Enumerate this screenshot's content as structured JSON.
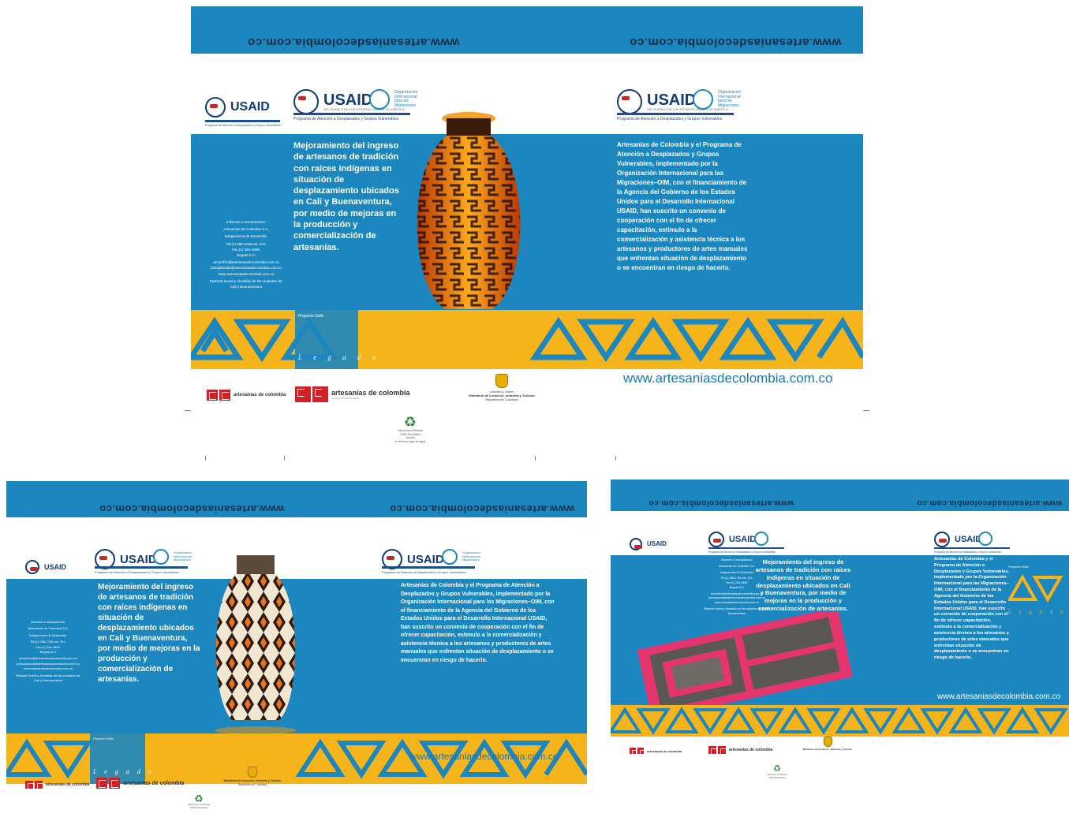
{
  "url_flipped": "www.artesaniasdecolombia.com.co",
  "url": "www.artesaniasdecolombia.com.co",
  "usaid": {
    "name": "USAID",
    "sub": "DEL PUEBLO DE LOS ESTADOS UNIDOS DE AMÉRICA"
  },
  "oim": {
    "line1": "Organización",
    "line2": "Internacional",
    "line3": "para las",
    "line4": "Migraciones"
  },
  "programa": "Programa de Atención a Desplazados y Grupos Vulnerables",
  "title": "Mejoramiento del ingreso de artesanos de tradición con raíces indígenas en situación de desplazamiento ubicados en Cali y Buenaventura, por medio de mejoras en la producción y comercialización de artesanías.",
  "body": "Artesanías de Colombia y el Programa de Atención a Desplazados y Grupos Vulnerables, implementado por la Organización Internacional para las Migraciones–OIM, con el financiamiento de la Agencia del Gobierno de los Estados Unidos para el Desarrollo Internacional USAID, han suscrito un convenio de cooperación con el fin de ofrecer capacitación, estimulo a la comercialización y asistencia técnica a los artesanos y productores de artes manuales que enfrentan situación de desplazamiento o se encuentran en riesgo de hacerlo.",
  "info": {
    "heading": "Informes e Inscripciones:",
    "org": "Artesanías de Colombia S.A.",
    "dept": "Subgerencia de Desarrollo.",
    "tel": "Tel:(1) 286-1766 ext. 241.",
    "fax": "Fax:(1) 284-1899.",
    "city": "Bogotá D.C",
    "email1": "amorrifon@artesaniasdecolombia.com.co",
    "email2": "pdsuplazada@artesaniasdecolombia.com.co",
    "web": "www.artesaniasdecolombia.com.co",
    "pastoral": "Pastoral Social y Alcaldías de las ciudades de: Cali y Buenaventura"
  },
  "legado": {
    "proyecto": "Proyecto Sello",
    "word": "L e g a d o"
  },
  "artesanias": {
    "name": "artesanías de colombia",
    "tagline": "creando nuestra identidad"
  },
  "mincom": {
    "line1": "Libertad y Orden",
    "line2": "Ministerio de Comercio, Industria y Turismo",
    "line3": "República de Colombia"
  },
  "recycle": {
    "line1": "Salvemos el Planeta",
    "line2": "100% Reciclable",
    "line3": "Cuídalo",
    "line4": "en el buen lugar de agua"
  },
  "colors": {
    "blue": "#1c86bf",
    "gold": "#f4b41a",
    "navy": "#142c44",
    "red": "#d32027"
  }
}
